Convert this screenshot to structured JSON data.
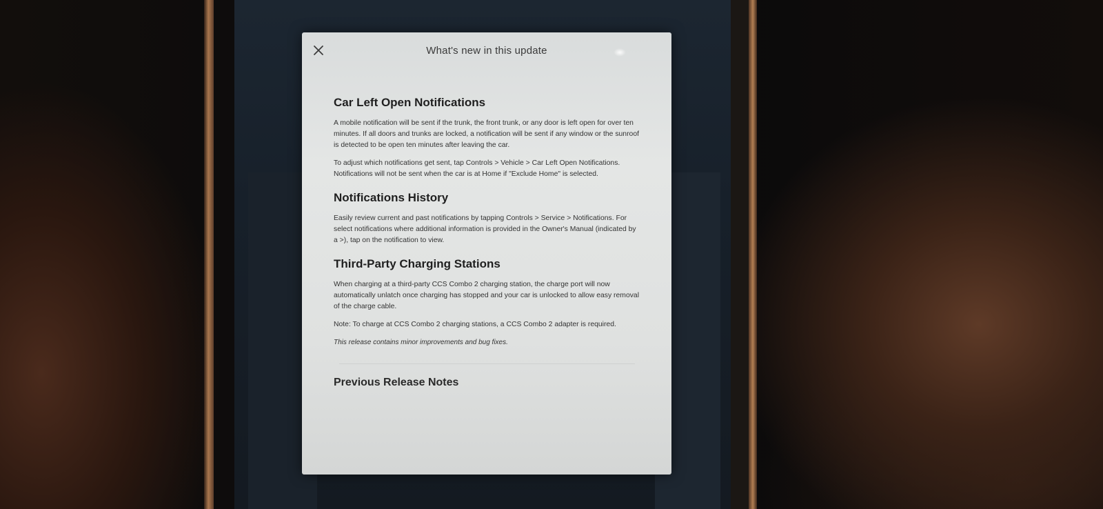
{
  "dialog": {
    "title": "What's new in this update",
    "close_icon": "close-icon"
  },
  "sections": [
    {
      "heading": "Car Left Open Notifications",
      "paragraphs": [
        "A mobile notification will be sent if the trunk, the front trunk, or any door is left open for over ten minutes. If all doors and trunks are locked, a notification will be sent if any window or the sunroof is detected to be open ten minutes after leaving the car.",
        "To adjust which notifications get sent, tap Controls > Vehicle > Car Left Open Notifications. Notifications will not be sent when the car is at Home if \"Exclude Home\" is selected."
      ]
    },
    {
      "heading": "Notifications History",
      "paragraphs": [
        "Easily review current and past notifications by tapping Controls > Service > Notifications. For select notifications where additional information is provided in the Owner's Manual (indicated by a >), tap on the notification to view."
      ]
    },
    {
      "heading": "Third-Party Charging Stations",
      "paragraphs": [
        "When charging at a third-party CCS Combo 2 charging station, the charge port will now automatically unlatch once charging has stopped and your car is unlocked to allow easy removal of the charge cable.",
        "Note: To charge at CCS Combo 2 charging stations, a CCS Combo 2 adapter is required."
      ]
    }
  ],
  "footer_note": "This release contains minor improvements and bug fixes.",
  "previous_link": "Previous Release Notes",
  "colors": {
    "panel_bg": "#e2e4e3",
    "heading": "#1f1f1f",
    "body_text": "#333333"
  }
}
